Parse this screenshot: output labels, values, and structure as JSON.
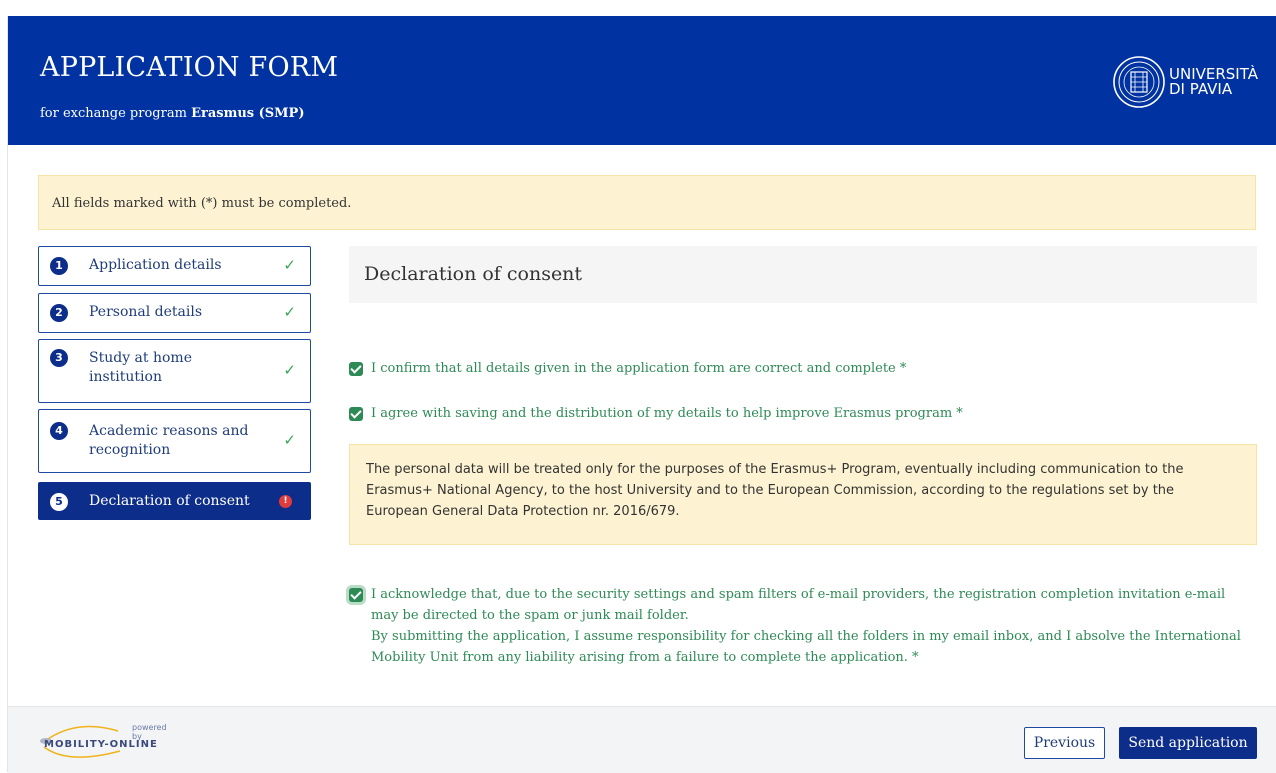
{
  "header": {
    "title": "APPLICATION FORM",
    "subtitle_prefix": "for exchange program",
    "subtitle_program": "Erasmus (SMP)",
    "university_line1": "UNIVERSITÀ",
    "university_line2": "DI PAVIA"
  },
  "notice": "All fields marked with (*) must be completed.",
  "steps": [
    {
      "num": "1",
      "label": "Application details",
      "status": "✓"
    },
    {
      "num": "2",
      "label": "Personal details",
      "status": "✓"
    },
    {
      "num": "3",
      "label": "Study at home institution",
      "status": "✓"
    },
    {
      "num": "4",
      "label": "Academic reasons and recognition",
      "status": "✓"
    },
    {
      "num": "5",
      "label": "Declaration of consent",
      "status": "!"
    }
  ],
  "section_title": "Declaration of consent",
  "consents": [
    {
      "text": "I confirm that all details given in the application form are correct and complete *",
      "checked": true
    },
    {
      "text": "I agree with saving and the distribution of my details to help improve Erasmus program *",
      "checked": true
    },
    {
      "text_line1": "I acknowledge that, due to the security settings and spam filters of e-mail providers, the registration completion invitation e-mail may be directed to the spam or junk mail folder.",
      "text_line2": "By submitting the application, I assume responsibility for checking all the folders in my email inbox, and I absolve the International Mobility Unit from any liability arising from a failure to complete the application. *",
      "checked": true
    }
  ],
  "privacy_note": "The personal data will be treated only for the purposes of the Erasmus+ Program, eventually including communication to the Erasmus+ National Agency, to the host University and to the European Commission, according to the regulations set by the European General Data Protection nr. 2016/679.",
  "footer": {
    "powered_by": "powered by",
    "brand": "MOBILITY-ONLINE",
    "previous_label": "Previous",
    "send_label": "Send application"
  },
  "colors": {
    "header_bg": "#0033a1",
    "primary": "#0d2d8a",
    "consent_green": "#2d8a55",
    "notice_bg": "#fdf3d2",
    "alert_red": "#e03c3c"
  }
}
